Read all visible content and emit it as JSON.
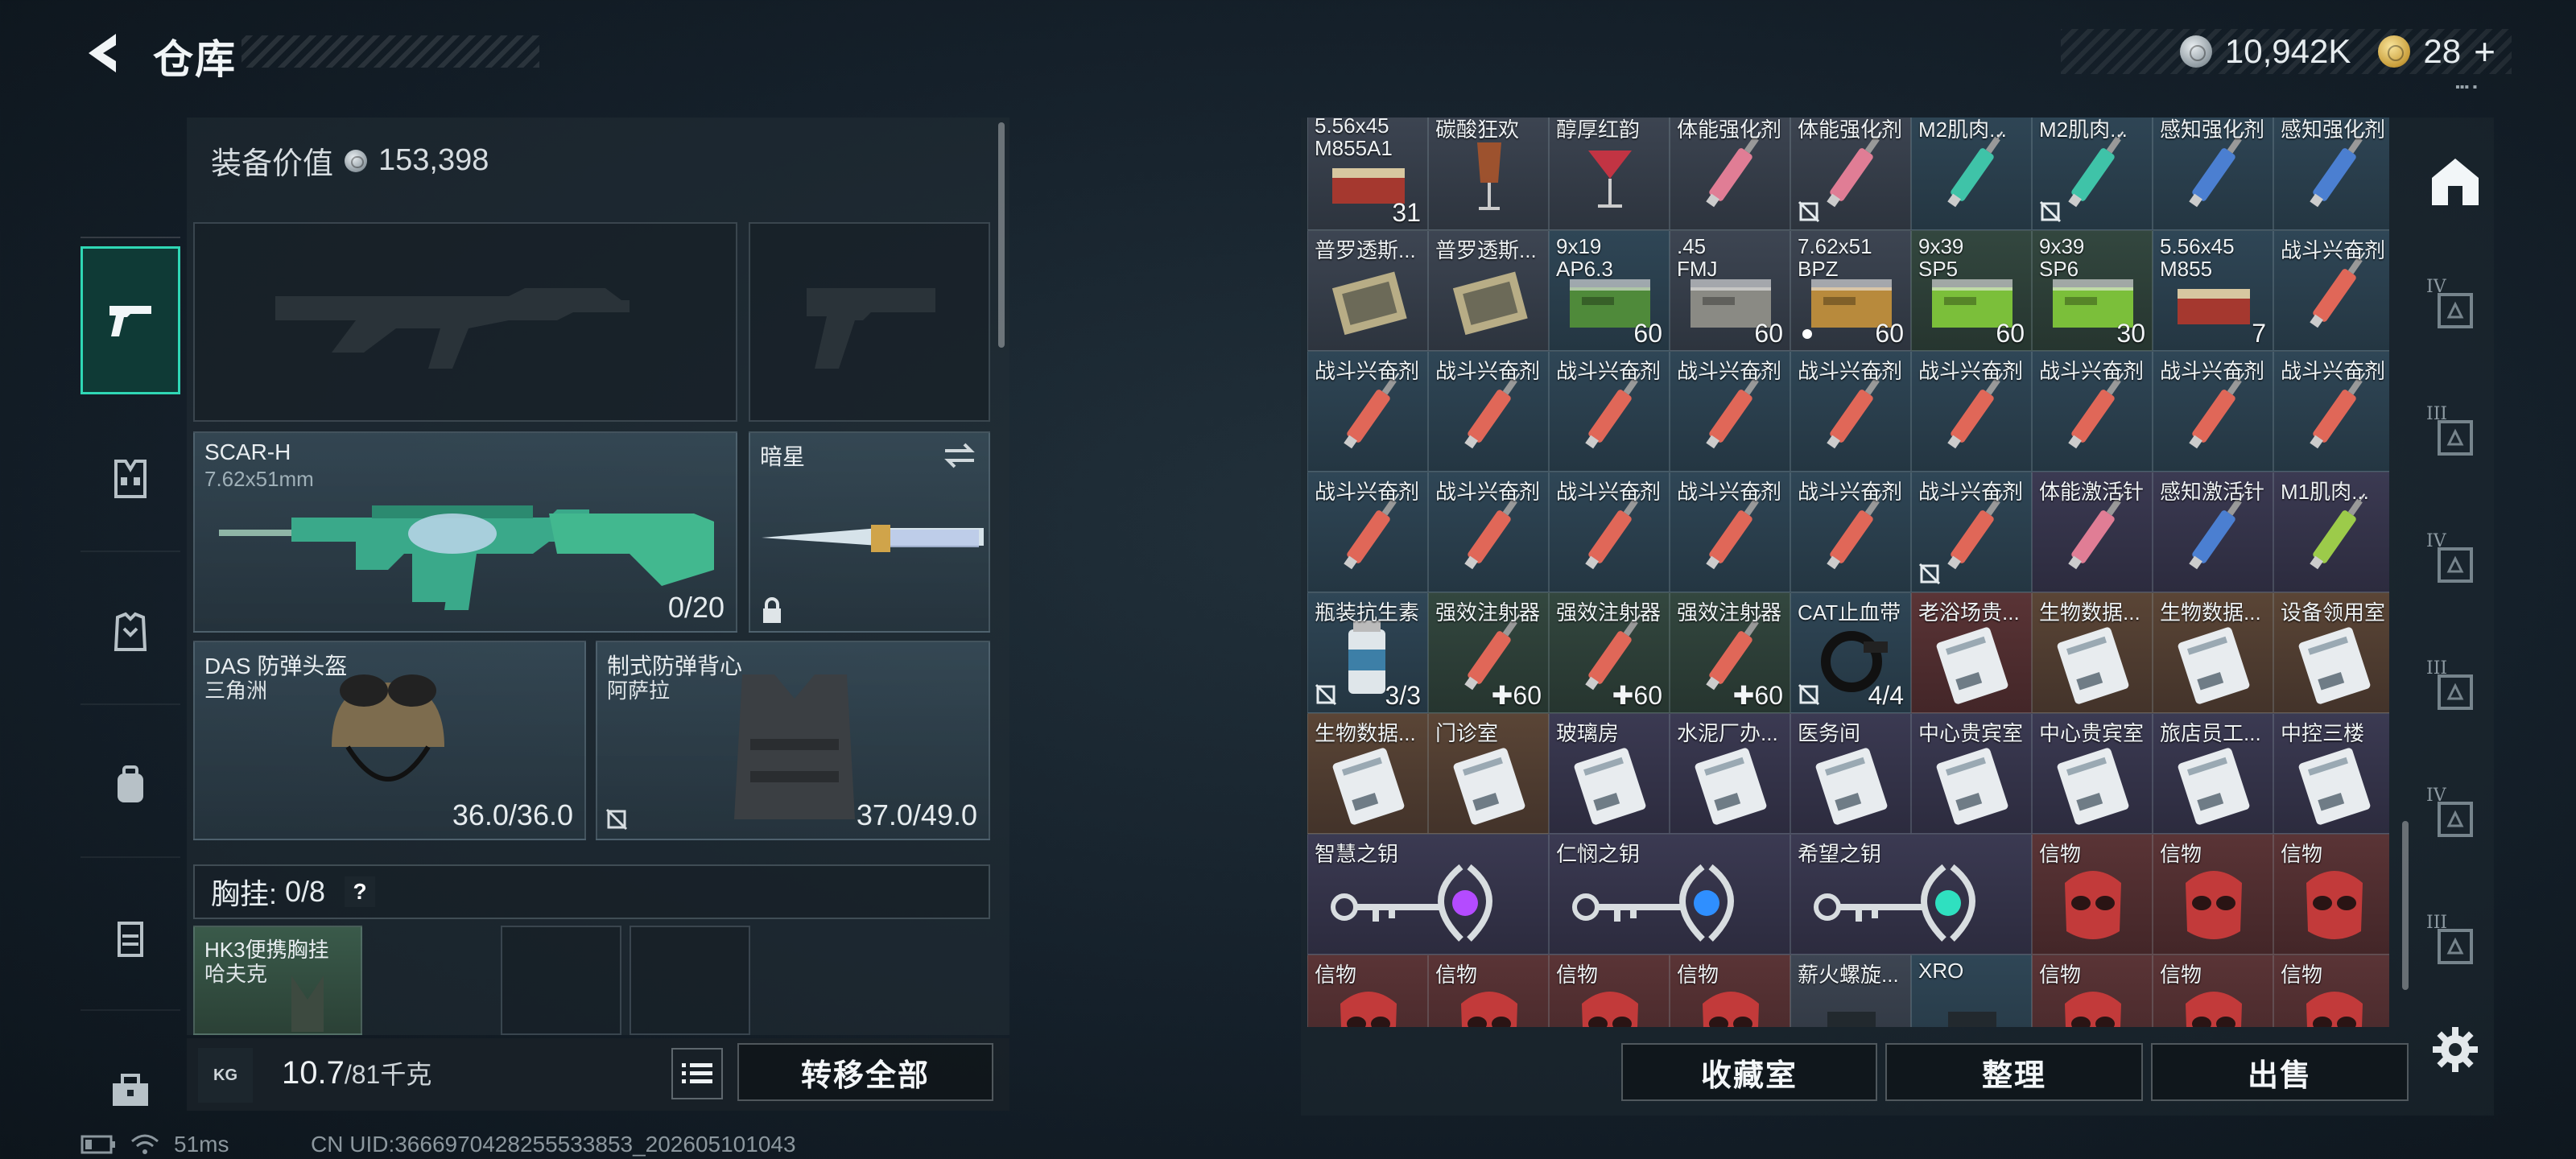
{
  "header": {
    "title": "仓库",
    "silver_amount": "10,942K",
    "gold_amount": "28",
    "gold_plus": "+"
  },
  "left_nav": [
    "weapon-icon",
    "ammo-rig-icon",
    "armor-icon",
    "backpack-icon",
    "rig-icon",
    "toolbox-icon"
  ],
  "equipment": {
    "value_label": "装备价值",
    "value": "153,398",
    "primary": {
      "name": "SCAR-H",
      "caliber": "7.62x51mm",
      "ammo": "0/20"
    },
    "melee": {
      "name": "暗星"
    },
    "helmet": {
      "name": "DAS 防弹头盔",
      "origin": "三角洲",
      "durability": "36.0/36.0"
    },
    "vest": {
      "name": "制式防弹背心",
      "origin": "阿萨拉",
      "durability": "37.0/49.0"
    },
    "chest": {
      "label": "胸挂:",
      "count": "0/8",
      "help": "?"
    },
    "chest_item": {
      "name": "HK3便携胸挂",
      "origin": "哈夫克"
    }
  },
  "footer": {
    "weight_icon": "KG",
    "weight_current": "10.7",
    "weight_max": "/81千克",
    "transfer_all": "转移全部",
    "collection_room": "收藏室",
    "organize": "整理",
    "sell": "出售"
  },
  "grid": [
    {
      "l1": "5.56x45",
      "l2": "M855A1",
      "count": "31",
      "color": "gray",
      "art": "ammo-red"
    },
    {
      "l1": "碳酸狂欢",
      "count": "",
      "color": "gray",
      "art": "glass-amber"
    },
    {
      "l1": "醇厚红韵",
      "count": "",
      "color": "gray",
      "art": "glass-red"
    },
    {
      "l1": "体能强化剂",
      "count": "",
      "color": "gray",
      "art": "syringe-pink"
    },
    {
      "l1": "体能强化剂",
      "count": "",
      "color": "gray",
      "art": "syringe-pink",
      "no": true
    },
    {
      "l1": "M2肌肉...",
      "count": "",
      "color": "blue",
      "art": "syringe-teal"
    },
    {
      "l1": "M2肌肉...",
      "count": "",
      "color": "blue",
      "art": "syringe-teal",
      "no": true
    },
    {
      "l1": "感知强化剂",
      "count": "",
      "color": "blue",
      "art": "syringe-blue"
    },
    {
      "l1": "感知强化剂",
      "count": "",
      "color": "blue",
      "art": "syringe-blue"
    },
    {
      "l1": "普罗透斯...",
      "count": "",
      "color": "gray",
      "art": "pouch"
    },
    {
      "l1": "普罗透斯...",
      "count": "",
      "color": "gray",
      "art": "pouch"
    },
    {
      "l1": "9x19",
      "l2": "AP6.3",
      "count": "60",
      "color": "blue",
      "art": "box-green"
    },
    {
      "l1": ".45",
      "l2": "FMJ",
      "count": "60",
      "color": "gray",
      "art": "box-gray"
    },
    {
      "l1": "7.62x51",
      "l2": "BPZ",
      "count": "60",
      "color": "gray",
      "art": "box-gold",
      "dot": true
    },
    {
      "l1": "9x39",
      "l2": "SP5",
      "count": "60",
      "color": "green",
      "art": "box-lime"
    },
    {
      "l1": "9x39",
      "l2": "SP6",
      "count": "30",
      "color": "green",
      "art": "box-lime"
    },
    {
      "l1": "5.56x45",
      "l2": "M855",
      "count": "7",
      "color": "blue",
      "art": "ammo-red"
    },
    {
      "l1": "战斗兴奋剂",
      "count": "",
      "color": "blue",
      "art": "syringe-red"
    },
    {
      "l1": "战斗兴奋剂",
      "count": "",
      "color": "blue",
      "art": "syringe-red"
    },
    {
      "l1": "战斗兴奋剂",
      "count": "",
      "color": "blue",
      "art": "syringe-red"
    },
    {
      "l1": "战斗兴奋剂",
      "count": "",
      "color": "blue",
      "art": "syringe-red"
    },
    {
      "l1": "战斗兴奋剂",
      "count": "",
      "color": "blue",
      "art": "syringe-red"
    },
    {
      "l1": "战斗兴奋剂",
      "count": "",
      "color": "blue",
      "art": "syringe-red"
    },
    {
      "l1": "战斗兴奋剂",
      "count": "",
      "color": "blue",
      "art": "syringe-red"
    },
    {
      "l1": "战斗兴奋剂",
      "count": "",
      "color": "blue",
      "art": "syringe-red"
    },
    {
      "l1": "战斗兴奋剂",
      "count": "",
      "color": "blue",
      "art": "syringe-red"
    },
    {
      "l1": "战斗兴奋剂",
      "count": "",
      "color": "blue",
      "art": "syringe-red"
    },
    {
      "l1": "战斗兴奋剂",
      "count": "",
      "color": "blue",
      "art": "syringe-red"
    },
    {
      "l1": "战斗兴奋剂",
      "count": "",
      "color": "blue",
      "art": "syringe-red"
    },
    {
      "l1": "战斗兴奋剂",
      "count": "",
      "color": "blue",
      "art": "syringe-red"
    },
    {
      "l1": "战斗兴奋剂",
      "count": "",
      "color": "blue",
      "art": "syringe-red"
    },
    {
      "l1": "战斗兴奋剂",
      "count": "",
      "color": "blue",
      "art": "syringe-red"
    },
    {
      "l1": "战斗兴奋剂",
      "count": "",
      "color": "blue",
      "art": "syringe-red",
      "no": true
    },
    {
      "l1": "体能激活针",
      "count": "",
      "color": "purple",
      "art": "syringe-pink"
    },
    {
      "l1": "感知激活针",
      "count": "",
      "color": "purple",
      "art": "syringe-blue"
    },
    {
      "l1": "M1肌肉...",
      "count": "",
      "color": "purple",
      "art": "syringe-lime"
    },
    {
      "l1": "瓶装抗生素",
      "count": "3/3",
      "color": "blue",
      "art": "bottle",
      "no": true
    },
    {
      "l1": "强效注射器",
      "count": "60",
      "plus": true,
      "color": "green",
      "art": "syringe-red"
    },
    {
      "l1": "强效注射器",
      "count": "60",
      "plus": true,
      "color": "green",
      "art": "syringe-red"
    },
    {
      "l1": "强效注射器",
      "count": "60",
      "plus": true,
      "color": "green",
      "art": "syringe-red"
    },
    {
      "l1": "CAT止血带",
      "count": "4/4",
      "color": "blue",
      "art": "tourniquet",
      "no": true
    },
    {
      "l1": "老浴场贵...",
      "count": "",
      "color": "red",
      "art": "keycard"
    },
    {
      "l1": "生物数据...",
      "count": "",
      "color": "orange",
      "art": "keycard"
    },
    {
      "l1": "生物数据...",
      "count": "",
      "color": "orange",
      "art": "keycard"
    },
    {
      "l1": "设备领用室",
      "count": "",
      "color": "orange",
      "art": "keycard"
    },
    {
      "l1": "生物数据...",
      "count": "",
      "color": "orange",
      "art": "keycard"
    },
    {
      "l1": "门诊室",
      "count": "",
      "color": "orange",
      "art": "keycard"
    },
    {
      "l1": "玻璃房",
      "count": "",
      "color": "purple",
      "art": "keycard"
    },
    {
      "l1": "水泥厂办...",
      "count": "",
      "color": "purple",
      "art": "keycard"
    },
    {
      "l1": "医务间",
      "count": "",
      "color": "purple",
      "art": "keycard"
    },
    {
      "l1": "中心贵宾室",
      "count": "",
      "color": "purple",
      "art": "keycard"
    },
    {
      "l1": "中心贵宾室",
      "count": "",
      "color": "purple",
      "art": "keycard"
    },
    {
      "l1": "旅店员工...",
      "count": "",
      "color": "purple",
      "art": "keycard"
    },
    {
      "l1": "中控三楼",
      "count": "",
      "color": "purple",
      "art": "keycard"
    }
  ],
  "keys_row": [
    {
      "l1": "智慧之钥",
      "color": "purple",
      "gem": "#b44bff"
    },
    {
      "l1": "仁悯之钥",
      "color": "purple",
      "gem": "#2f8fff"
    },
    {
      "l1": "希望之钥",
      "color": "purple",
      "gem": "#2fe0c0"
    }
  ],
  "relic_row": [
    {
      "l1": "信物",
      "color": "red"
    },
    {
      "l1": "信物",
      "color": "red"
    },
    {
      "l1": "信物",
      "color": "red"
    }
  ],
  "bottom_row": [
    {
      "l1": "信物",
      "color": "red",
      "art": "mask"
    },
    {
      "l1": "信物",
      "color": "red",
      "art": "mask"
    },
    {
      "l1": "信物",
      "color": "red",
      "art": "mask"
    },
    {
      "l1": "信物",
      "color": "red",
      "art": "mask"
    },
    {
      "l1": "薪火螺旋...",
      "color": "gray",
      "art": "dark"
    },
    {
      "l1": "XRO",
      "color": "blue",
      "art": "dark"
    },
    {
      "l1": "信物",
      "color": "red",
      "art": "mask"
    },
    {
      "l1": "信物",
      "color": "red",
      "art": "mask"
    },
    {
      "l1": "信物",
      "color": "red",
      "art": "mask"
    }
  ],
  "right_nav_levels": [
    "",
    "IV",
    "III",
    "IV",
    "III",
    "IV",
    "III"
  ],
  "status": {
    "ping": "51ms",
    "uid": "CN UID:3666970428255533853_202605101043"
  }
}
